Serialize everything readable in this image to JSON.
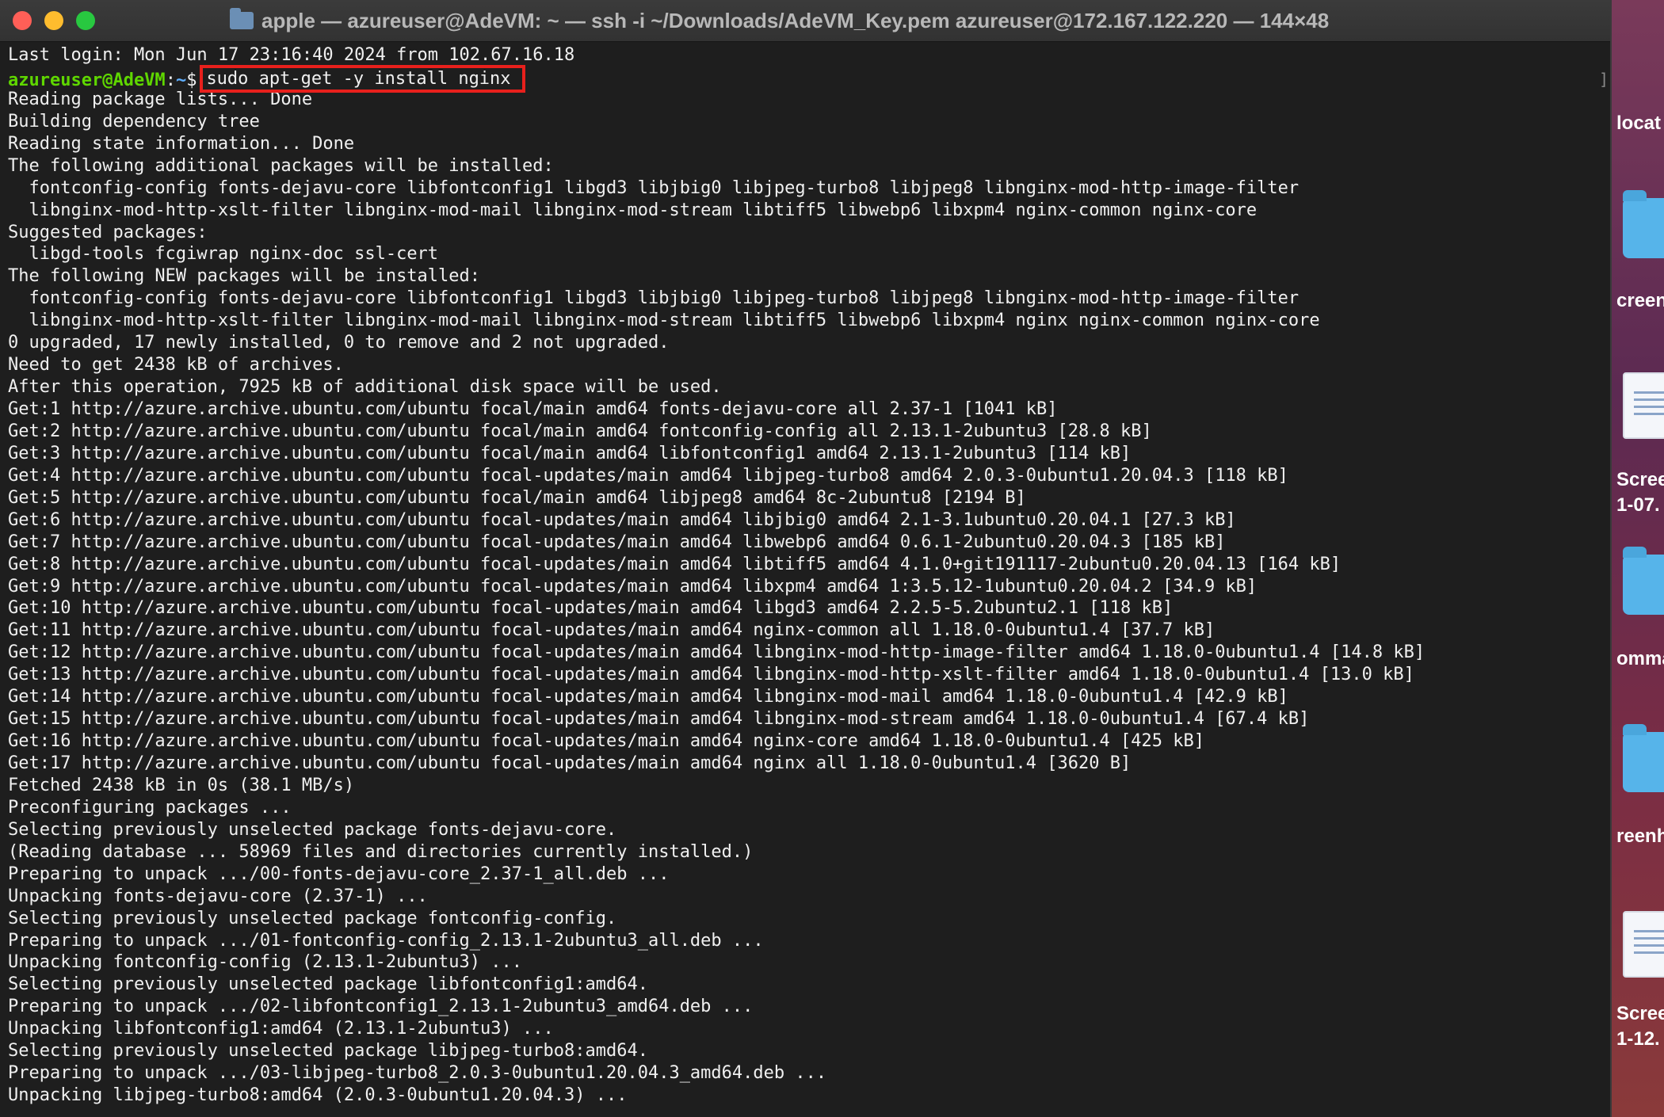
{
  "window": {
    "title": "apple — azureuser@AdeVM: ~ — ssh -i ~/Downloads/AdeVM_Key.pem azureuser@172.167.122.220 — 144×48"
  },
  "prompt": {
    "user_host": "azureuser@AdeVM",
    "separator": ":",
    "path": "~",
    "symbol": "$",
    "command": "sudo apt-get -y install nginx"
  },
  "terminal": {
    "last_login": "Last login: Mon Jun 17 23:16:40 2024 from 102.67.16.18",
    "output": [
      "Reading package lists... Done",
      "Building dependency tree",
      "Reading state information... Done",
      "The following additional packages will be installed:",
      "  fontconfig-config fonts-dejavu-core libfontconfig1 libgd3 libjbig0 libjpeg-turbo8 libjpeg8 libnginx-mod-http-image-filter",
      "  libnginx-mod-http-xslt-filter libnginx-mod-mail libnginx-mod-stream libtiff5 libwebp6 libxpm4 nginx-common nginx-core",
      "Suggested packages:",
      "  libgd-tools fcgiwrap nginx-doc ssl-cert",
      "The following NEW packages will be installed:",
      "  fontconfig-config fonts-dejavu-core libfontconfig1 libgd3 libjbig0 libjpeg-turbo8 libjpeg8 libnginx-mod-http-image-filter",
      "  libnginx-mod-http-xslt-filter libnginx-mod-mail libnginx-mod-stream libtiff5 libwebp6 libxpm4 nginx nginx-common nginx-core",
      "0 upgraded, 17 newly installed, 0 to remove and 2 not upgraded.",
      "Need to get 2438 kB of archives.",
      "After this operation, 7925 kB of additional disk space will be used.",
      "Get:1 http://azure.archive.ubuntu.com/ubuntu focal/main amd64 fonts-dejavu-core all 2.37-1 [1041 kB]",
      "Get:2 http://azure.archive.ubuntu.com/ubuntu focal/main amd64 fontconfig-config all 2.13.1-2ubuntu3 [28.8 kB]",
      "Get:3 http://azure.archive.ubuntu.com/ubuntu focal/main amd64 libfontconfig1 amd64 2.13.1-2ubuntu3 [114 kB]",
      "Get:4 http://azure.archive.ubuntu.com/ubuntu focal-updates/main amd64 libjpeg-turbo8 amd64 2.0.3-0ubuntu1.20.04.3 [118 kB]",
      "Get:5 http://azure.archive.ubuntu.com/ubuntu focal/main amd64 libjpeg8 amd64 8c-2ubuntu8 [2194 B]",
      "Get:6 http://azure.archive.ubuntu.com/ubuntu focal-updates/main amd64 libjbig0 amd64 2.1-3.1ubuntu0.20.04.1 [27.3 kB]",
      "Get:7 http://azure.archive.ubuntu.com/ubuntu focal-updates/main amd64 libwebp6 amd64 0.6.1-2ubuntu0.20.04.3 [185 kB]",
      "Get:8 http://azure.archive.ubuntu.com/ubuntu focal-updates/main amd64 libtiff5 amd64 4.1.0+git191117-2ubuntu0.20.04.13 [164 kB]",
      "Get:9 http://azure.archive.ubuntu.com/ubuntu focal-updates/main amd64 libxpm4 amd64 1:3.5.12-1ubuntu0.20.04.2 [34.9 kB]",
      "Get:10 http://azure.archive.ubuntu.com/ubuntu focal-updates/main amd64 libgd3 amd64 2.2.5-5.2ubuntu2.1 [118 kB]",
      "Get:11 http://azure.archive.ubuntu.com/ubuntu focal-updates/main amd64 nginx-common all 1.18.0-0ubuntu1.4 [37.7 kB]",
      "Get:12 http://azure.archive.ubuntu.com/ubuntu focal-updates/main amd64 libnginx-mod-http-image-filter amd64 1.18.0-0ubuntu1.4 [14.8 kB]",
      "Get:13 http://azure.archive.ubuntu.com/ubuntu focal-updates/main amd64 libnginx-mod-http-xslt-filter amd64 1.18.0-0ubuntu1.4 [13.0 kB]",
      "Get:14 http://azure.archive.ubuntu.com/ubuntu focal-updates/main amd64 libnginx-mod-mail amd64 1.18.0-0ubuntu1.4 [42.9 kB]",
      "Get:15 http://azure.archive.ubuntu.com/ubuntu focal-updates/main amd64 libnginx-mod-stream amd64 1.18.0-0ubuntu1.4 [67.4 kB]",
      "Get:16 http://azure.archive.ubuntu.com/ubuntu focal-updates/main amd64 nginx-core amd64 1.18.0-0ubuntu1.4 [425 kB]",
      "Get:17 http://azure.archive.ubuntu.com/ubuntu focal-updates/main amd64 nginx all 1.18.0-0ubuntu1.4 [3620 B]",
      "Fetched 2438 kB in 0s (38.1 MB/s)",
      "Preconfiguring packages ...",
      "Selecting previously unselected package fonts-dejavu-core.",
      "(Reading database ... 58969 files and directories currently installed.)",
      "Preparing to unpack .../00-fonts-dejavu-core_2.37-1_all.deb ...",
      "Unpacking fonts-dejavu-core (2.37-1) ...",
      "Selecting previously unselected package fontconfig-config.",
      "Preparing to unpack .../01-fontconfig-config_2.13.1-2ubuntu3_all.deb ...",
      "Unpacking fontconfig-config (2.13.1-2ubuntu3) ...",
      "Selecting previously unselected package libfontconfig1:amd64.",
      "Preparing to unpack .../02-libfontconfig1_2.13.1-2ubuntu3_amd64.deb ...",
      "Unpacking libfontconfig1:amd64 (2.13.1-2ubuntu3) ...",
      "Selecting previously unselected package libjpeg-turbo8:amd64.",
      "Preparing to unpack .../03-libjpeg-turbo8_2.0.3-0ubuntu1.20.04.3_amd64.deb ...",
      "Unpacking libjpeg-turbo8:amd64 (2.0.3-0ubuntu1.20.04.3) ..."
    ]
  },
  "desktop": {
    "labels": [
      "locat",
      "creen",
      "Scree",
      "1-07.",
      "omma",
      "reenh",
      "Scree",
      "1-12."
    ]
  },
  "colors": {
    "highlight_box": "#e8201c",
    "prompt_user": "#5fd700",
    "prompt_path": "#5fafff",
    "terminal_bg": "#1e1e1e"
  }
}
